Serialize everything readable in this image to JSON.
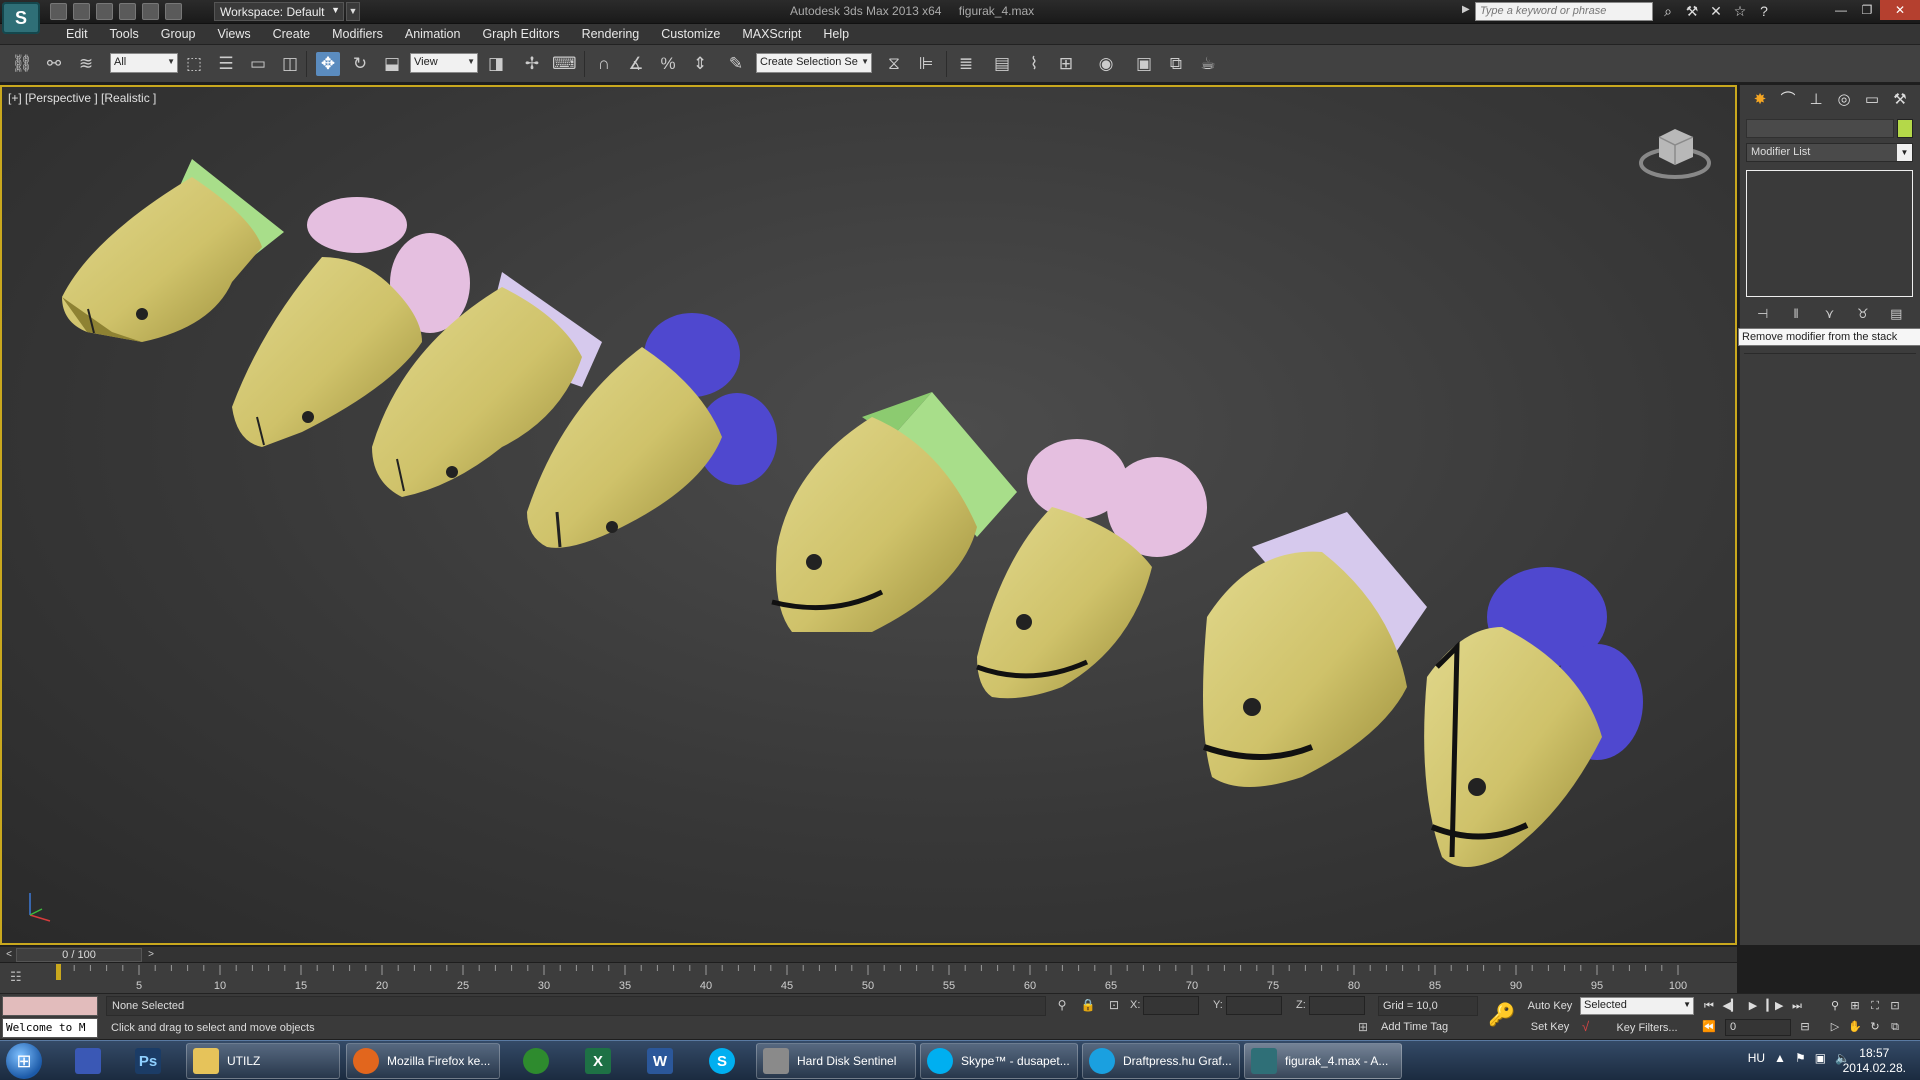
{
  "app": {
    "logo": "S",
    "title": "Autodesk 3ds Max 2013 x64",
    "file": "figurak_4.max",
    "workspace": "Workspace: Default",
    "search_placeholder": "Type a keyword or phrase",
    "accent": "#c9a81e"
  },
  "menu": [
    "Edit",
    "Tools",
    "Group",
    "Views",
    "Create",
    "Modifiers",
    "Animation",
    "Graph Editors",
    "Rendering",
    "Customize",
    "MAXScript",
    "Help"
  ],
  "toolbar": {
    "filter": "All",
    "ref_coord": "View",
    "selection_set_placeholder": "Create Selection Se"
  },
  "viewport": {
    "label": "[+] [Perspective ] [Realistic ]"
  },
  "command_panel": {
    "modifier_list": "Modifier List",
    "tooltip": "Remove modifier from the stack",
    "object_color": "#b4d849"
  },
  "timeline": {
    "slider": "0 / 100",
    "prev": "<",
    "next": ">",
    "ticks": [
      "5",
      "10",
      "15",
      "20",
      "25",
      "30",
      "35",
      "40",
      "45",
      "50",
      "55",
      "60",
      "65",
      "70",
      "75",
      "80",
      "85",
      "90",
      "95",
      "100"
    ]
  },
  "status": {
    "selection": "None Selected",
    "prompt": "Click and drag to select and move objects",
    "listener": "Welcome to M",
    "x_label": "X:",
    "y_label": "Y:",
    "z_label": "Z:",
    "grid": "Grid = 10,0",
    "add_time_tag": "Add Time Tag",
    "auto_key": "Auto Key",
    "set_key": "Set Key",
    "key_mode": "Selected",
    "key_filters": "Key Filters...",
    "frame": "0"
  },
  "taskbar": {
    "items": [
      {
        "label": "",
        "icon": "floppy-icon",
        "color": "#3a58b5"
      },
      {
        "label": "Ps",
        "icon": "photoshop-icon",
        "color": "#1b3c66"
      },
      {
        "label": "UTILZ",
        "icon": "folder-icon",
        "color": "#e6c35a"
      },
      {
        "label": "Mozilla Firefox ke...",
        "icon": "firefox-icon",
        "color": "#e2661d"
      },
      {
        "label": "",
        "icon": "utorrent-icon",
        "color": "#2e8b2e"
      },
      {
        "label": "X",
        "icon": "excel-icon",
        "color": "#1e7145"
      },
      {
        "label": "W",
        "icon": "word-icon",
        "color": "#2b579a"
      },
      {
        "label": "S",
        "icon": "skype-icon",
        "color": "#00aff0"
      },
      {
        "label": "Hard Disk Sentinel",
        "icon": "hdd-icon",
        "color": "#8a8a8a"
      },
      {
        "label": "Skype™ - dusapet...",
        "icon": "skype-icon",
        "color": "#00aff0"
      },
      {
        "label": "Draftpress.hu Graf...",
        "icon": "chat-icon",
        "color": "#1aa0e0"
      },
      {
        "label": "figurak_4.max - A...",
        "icon": "3dsmax-icon",
        "color": "#2f6f77"
      }
    ],
    "lang": "HU",
    "time": "18:57",
    "date": "2014.02.28."
  }
}
